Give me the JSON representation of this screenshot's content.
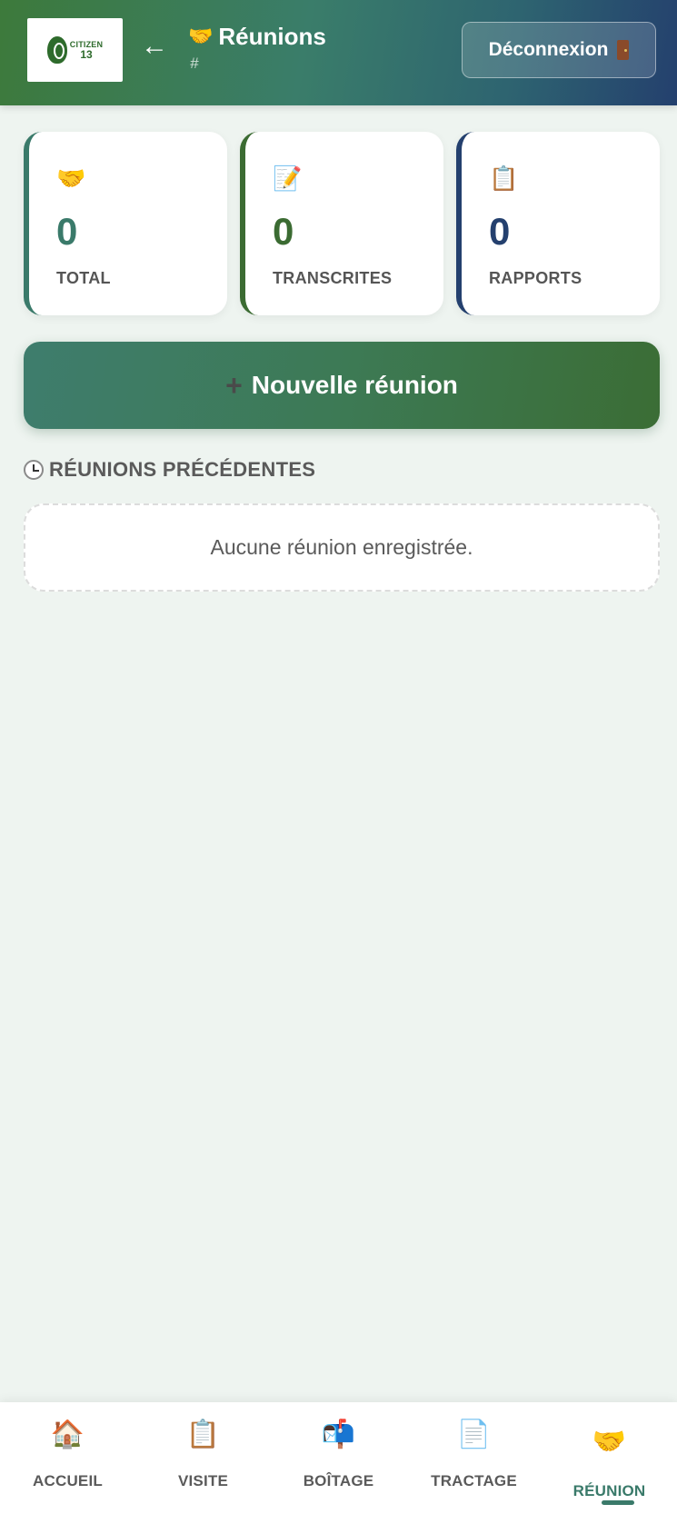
{
  "header": {
    "logo_word": "CITIZEN",
    "logo_number": "13",
    "back_icon": "←",
    "title_emoji": "🤝",
    "title": "Réunions",
    "subtitle": "#",
    "logout_label": "Déconnexion"
  },
  "stats": [
    {
      "icon": "🤝",
      "value": "0",
      "label": "TOTAL"
    },
    {
      "icon": "📝",
      "value": "0",
      "label": "TRANSCRITES"
    },
    {
      "icon": "📋",
      "value": "0",
      "label": "RAPPORTS"
    }
  ],
  "new_meeting": {
    "plus": "+",
    "label": "Nouvelle réunion"
  },
  "section": {
    "title": "RÉUNIONS PRÉCÉDENTES",
    "empty_text": "Aucune réunion enregistrée."
  },
  "nav": [
    {
      "icon": "🏠",
      "label": "ACCUEIL"
    },
    {
      "icon": "📋",
      "label": "VISITE"
    },
    {
      "icon": "📬",
      "label": "BOÎTAGE"
    },
    {
      "icon": "📄",
      "label": "TRACTAGE"
    },
    {
      "icon": "🤝",
      "label": "RÉUNION"
    }
  ],
  "colors": {
    "accent_green": "#3a7a6a",
    "dark_green": "#3b6b32",
    "navy": "#24406e",
    "background": "#eef4f0"
  }
}
